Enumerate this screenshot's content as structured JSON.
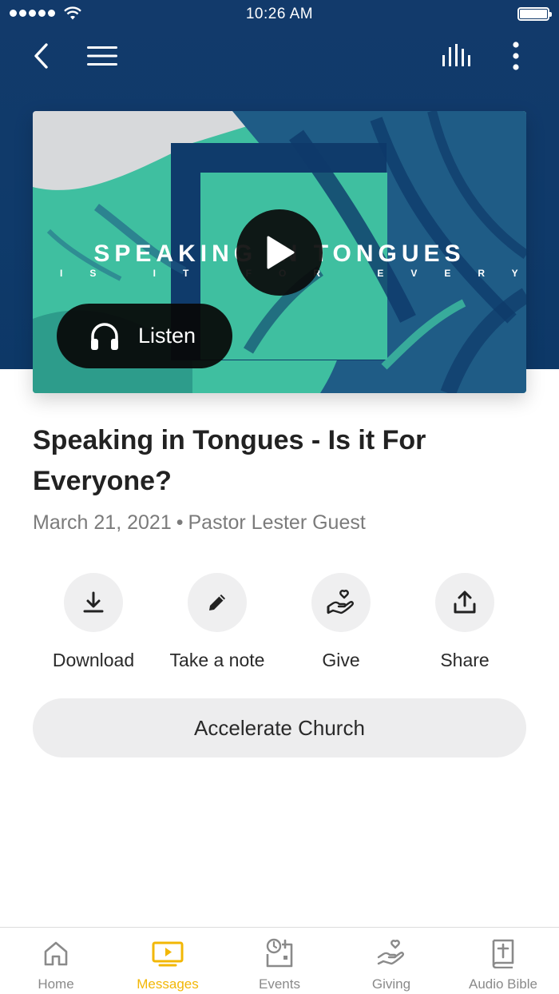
{
  "status_bar": {
    "time": "10:26 AM"
  },
  "nav": {
    "icons": [
      "back-icon",
      "menu-icon",
      "audio-bars-icon",
      "more-vertical-icon"
    ]
  },
  "artwork": {
    "title": "SPEAKING IN TONGUES",
    "subtitle": "IS IT FOR EVERYONE?",
    "listen_label": "Listen",
    "colors": {
      "teal": "#3fbfa0",
      "navy": "#0e3a6a",
      "grey": "#d4d6d8"
    }
  },
  "message": {
    "title": "Speaking in Tongues - Is it For Everyone?",
    "date": "March 21, 2021",
    "separator": "•",
    "speaker": "Pastor Lester Guest"
  },
  "actions": [
    {
      "label": "Download",
      "icon": "download-icon"
    },
    {
      "label": "Take a note",
      "icon": "pencil-icon"
    },
    {
      "label": "Give",
      "icon": "give-heart-hand-icon"
    },
    {
      "label": "Share",
      "icon": "share-icon"
    }
  ],
  "church_button": {
    "label": "Accelerate Church"
  },
  "tabs": [
    {
      "label": "Home",
      "icon": "home-icon",
      "active": false
    },
    {
      "label": "Messages",
      "icon": "messages-tv-icon",
      "active": true
    },
    {
      "label": "Events",
      "icon": "events-calendar-icon",
      "active": false
    },
    {
      "label": "Giving",
      "icon": "giving-icon",
      "active": false
    },
    {
      "label": "Audio Bible",
      "icon": "bible-icon",
      "active": false
    }
  ],
  "colors": {
    "accent": "#f2b705",
    "header": "#123a6b"
  }
}
